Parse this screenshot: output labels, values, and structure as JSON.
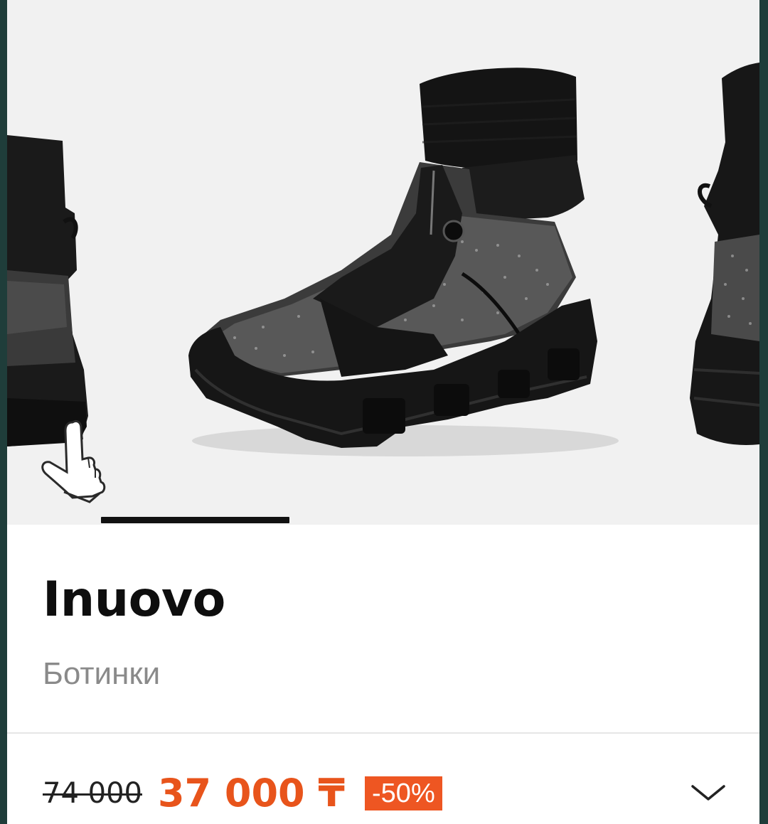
{
  "product": {
    "brand": "Inuovo",
    "category": "Ботинки",
    "old_price": "74 000",
    "new_price": "37 000 ₸",
    "discount": "-50%"
  },
  "gallery": {
    "active_slide": 1,
    "image_subject": "boot-photo"
  },
  "colors": {
    "price_accent": "#e8541b",
    "badge_background": "#ee5622",
    "brand_text": "#0e0e0e",
    "category_text": "#8a8a8a"
  },
  "icons": {
    "expand": "chevron-down-icon",
    "swipe_hint": "hand-pointer-icon"
  }
}
